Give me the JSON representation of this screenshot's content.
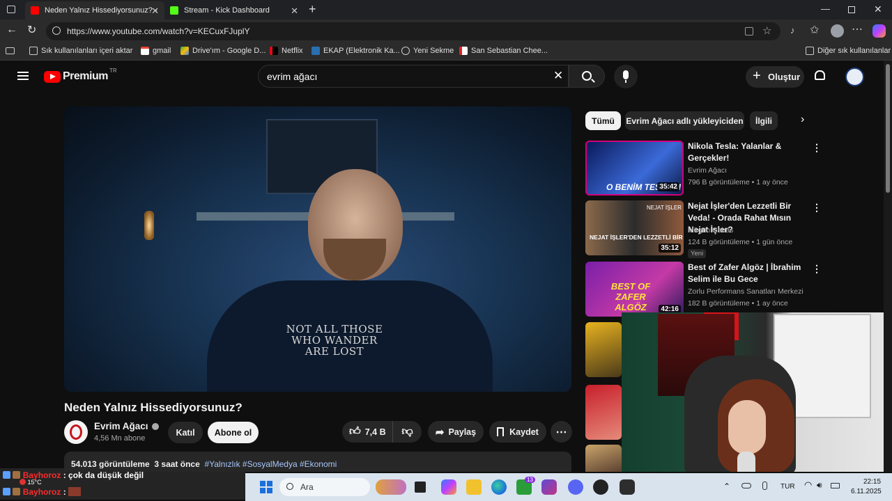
{
  "browser": {
    "tabs": [
      {
        "title": "Neden Yalnız Hissediyorsunuz? -",
        "active": true
      },
      {
        "title": "Stream - Kick Dashboard",
        "active": false
      }
    ],
    "url": "https://www.youtube.com/watch?v=KECuxFJuplY",
    "bookmarks": [
      "Sık kullanılanları içeri aktar",
      "gmail",
      "Drive'ım - Google D...",
      "Netflix",
      "EKAP (Elektronik Ka...",
      "Yeni Sekme",
      "San Sebastian Chee..."
    ],
    "other_bookmarks": "Diğer sık kullanılanlar"
  },
  "youtube": {
    "logo_text": "Premium",
    "logo_region": "TR",
    "search_value": "evrim ağacı",
    "create_label": "Oluştur",
    "video": {
      "title": "Neden Yalnız Hissediyorsunuz?",
      "shirt_text": "NOT ALL THOSE WHO WANDER ARE LOST",
      "channel": "Evrim Ağacı",
      "subscribers": "4,56 Mn abone",
      "join_label": "Katıl",
      "subscribe_label": "Abone ol",
      "likes": "7,4 B",
      "share_label": "Paylaş",
      "save_label": "Kaydet",
      "views": "54.013 görüntüleme",
      "time": "3 saat önce",
      "tags": "#Yalnızlık #SosyalMedya #Ekonomi"
    },
    "chips": [
      "Tümü",
      "Evrim Ağacı adlı yükleyiciden",
      "İlgili"
    ],
    "recommendations": [
      {
        "title": "Nikola Tesla: Yalanlar & Gerçekler!",
        "channel": "Evrim Ağacı",
        "meta": "796 B görüntüleme • 1 ay önce",
        "duration": "35:42",
        "thumb_text": "O BENİM TESLA'M",
        "badge": ""
      },
      {
        "title": "Nejat İşler'den Lezzetli Bir Veda! - Orada Rahat Mısın Nejat İşler?",
        "channel": "Mirgün Cabas",
        "meta": "124 B görüntüleme • 1 gün önce",
        "duration": "35:12",
        "thumb_text": "NEJAT İŞLER'DEN LEZZETLİ BİR VEDA",
        "thumb_tag": "NEJAT İŞLER",
        "badge": "Yeni"
      },
      {
        "title": "Best of Zafer Algöz | İbrahim Selim ile Bu Gece",
        "channel": "Zorlu Performans Sanatları Merkezi",
        "meta": "182 B görüntüleme • 1 ay önce",
        "duration": "42:16",
        "thumb_text": "BEST OF ZAFER ALGÖZ",
        "badge": ""
      }
    ]
  },
  "chat": {
    "lines": [
      {
        "user": "Bayhoroz",
        "message": ": çok da düşük değil"
      },
      {
        "user": "Bayhoroz",
        "message": ":"
      }
    ],
    "weather": "15°C"
  },
  "taskbar": {
    "search_placeholder": "Ara",
    "language": "TUR",
    "time": "22:15",
    "date": "6.11.2025",
    "badge_count": "13"
  },
  "colors": {
    "youtube_red": "#ff0000",
    "accent_blue": "#3ea6ff",
    "chat_user": "#ff2a2a"
  }
}
